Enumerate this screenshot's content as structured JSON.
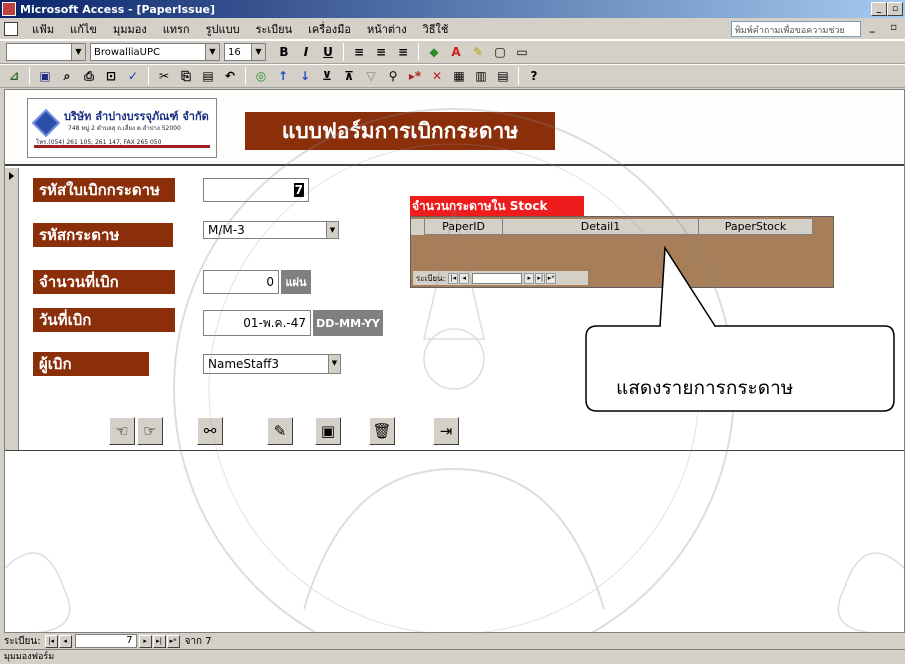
{
  "window": {
    "title": "Microsoft Access - [PaperIssue]",
    "controls": [
      "_",
      "▫",
      "×"
    ]
  },
  "menubar": {
    "items": [
      "แฟ้ม",
      "แก้ไข",
      "มุมมอง",
      "แทรก",
      "รูปแบบ",
      "ระเบียน",
      "เครื่องมือ",
      "หน้าต่าง",
      "วิธีใช้"
    ],
    "help_placeholder": "พิมพ์คำถามเพื่อขอความช่วย"
  },
  "toolbar1": {
    "font_name": "BrowalliaUPC",
    "font_size": "16",
    "buttons": [
      "B",
      "I",
      "U"
    ]
  },
  "form": {
    "title": "แบบฟอร์มการเบิกกระดาษ",
    "logo": {
      "company": "บริษัท ลำปางบรรจุภัณฑ์ จำกัด",
      "address_line1": "748 หมู่ 2 ตำบลสุ ถ.เลี่ยง ต.ลำปาง 52000",
      "address_line2": "โทร.(054) 261 105, 261 147, FAX 265 050"
    },
    "labels": {
      "slip_id": "รหัสใบเบิกกระดาษ",
      "paper_id": "รหัสกระดาษ",
      "quantity": "จำนวนที่เบิก",
      "date": "วันที่เบิก",
      "issuer": "ผู้เบิก"
    },
    "values": {
      "slip_id": "7",
      "paper_id": "M/M-3",
      "quantity": "0",
      "date": "01-พ.ค.-47",
      "issuer": "NameStaff3"
    },
    "units": {
      "quantity": "แผ่น",
      "date_format": "DD-MM-YY"
    }
  },
  "subform": {
    "label": "จำนวนกระดาษใน Stock",
    "columns": [
      "PaperID",
      "Detail1",
      "PaperStock"
    ],
    "nav_label": "ระเบียน:"
  },
  "callout": {
    "text": "แสดงรายการกระดาษ"
  },
  "navigation": {
    "label": "ระเบียน:",
    "current": "7",
    "total_text": "จาก 7"
  },
  "statusbar": {
    "text": "มุมมองฟอร์ม"
  }
}
